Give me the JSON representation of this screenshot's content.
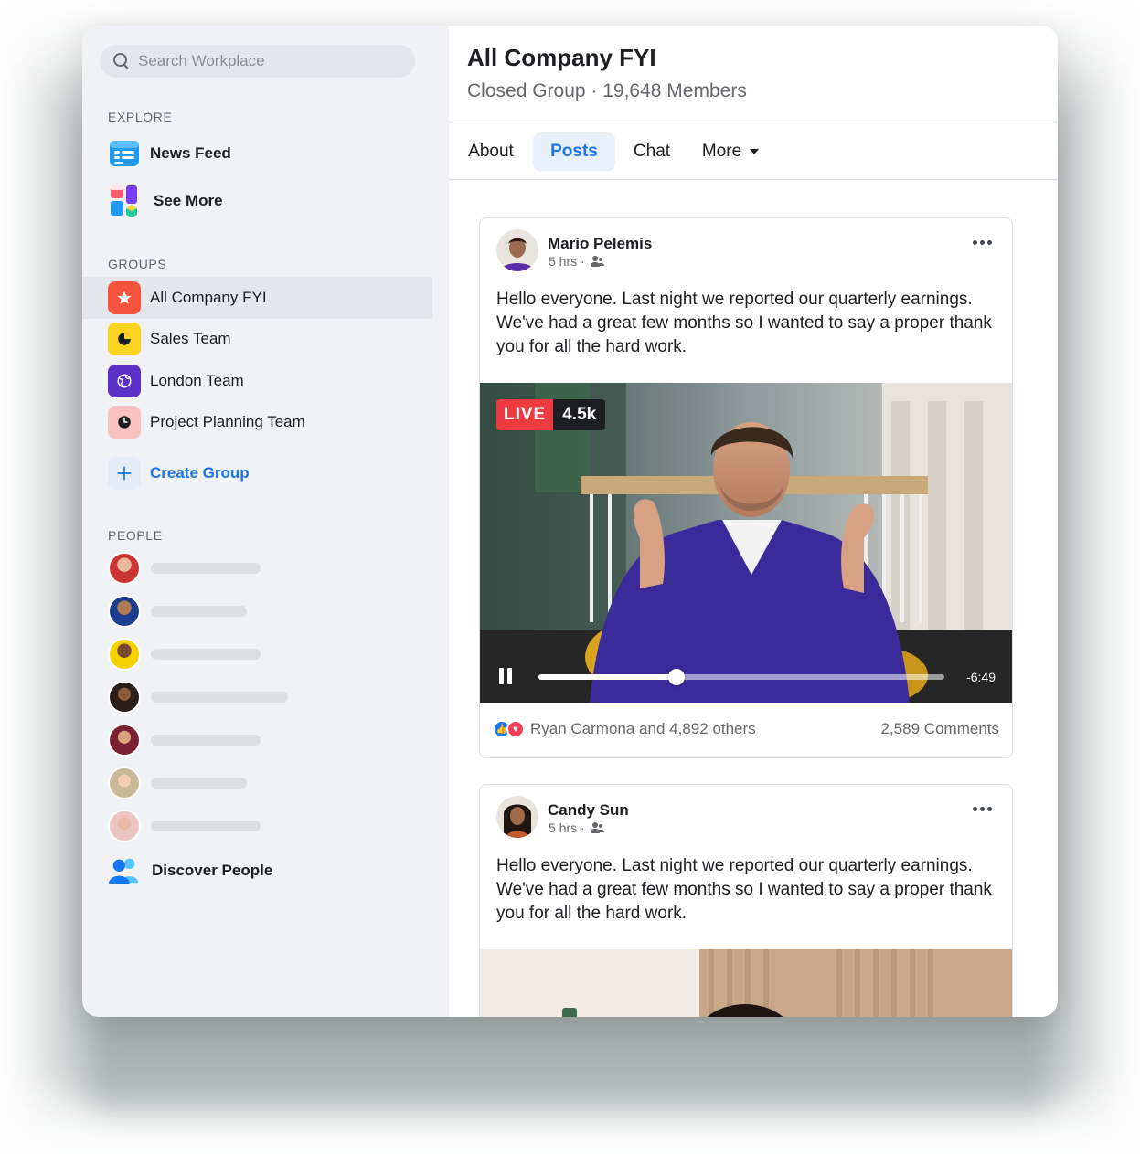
{
  "search": {
    "placeholder": "Search Workplace"
  },
  "sidebar": {
    "explore_label": "EXPLORE",
    "explore": [
      {
        "label": "News Feed",
        "icon": "news-feed-icon"
      },
      {
        "label": "See More",
        "icon": "apps-grid-icon"
      }
    ],
    "groups_label": "GROUPS",
    "groups": [
      {
        "label": "All Company FYI",
        "icon": "star-icon",
        "color": "#f5533d",
        "active": true
      },
      {
        "label": "Sales Team",
        "icon": "chart-icon",
        "color": "#fbd321"
      },
      {
        "label": "London Team",
        "icon": "globe-icon",
        "color": "#5b30c7"
      },
      {
        "label": "Project Planning Team",
        "icon": "clock-icon",
        "color": "#f7b7b5"
      }
    ],
    "create_group": "Create Group",
    "people_label": "PEOPLE",
    "discover_people": "Discover People"
  },
  "group": {
    "title": "All Company FYI",
    "subtitle": "Closed Group · 19,648 Members"
  },
  "tabs": [
    {
      "label": "About"
    },
    {
      "label": "Posts",
      "active": true
    },
    {
      "label": "Chat"
    },
    {
      "label": "More"
    }
  ],
  "posts": [
    {
      "author": "Mario Pelemis",
      "time": "5 hrs ·",
      "text": "Hello everyone. Last night we reported our quarterly earnings. We've had a great few months so I wanted to say a proper thank you for all the hard work.",
      "live_label": "LIVE",
      "viewers": "4.5k",
      "time_remaining": "-6:49",
      "progress": 0.34,
      "reactions_text": "Ryan Carmona and 4,892 others",
      "comments_text": "2,589 Comments"
    },
    {
      "author": "Candy Sun",
      "time": "5 hrs ·",
      "text": "Hello everyone. Last night we reported our quarterly earnings. We've had a great few months so I wanted to say a proper thank you for all the hard work."
    }
  ],
  "colors": {
    "accent": "#1b74e4",
    "live": "#ee3b40"
  }
}
